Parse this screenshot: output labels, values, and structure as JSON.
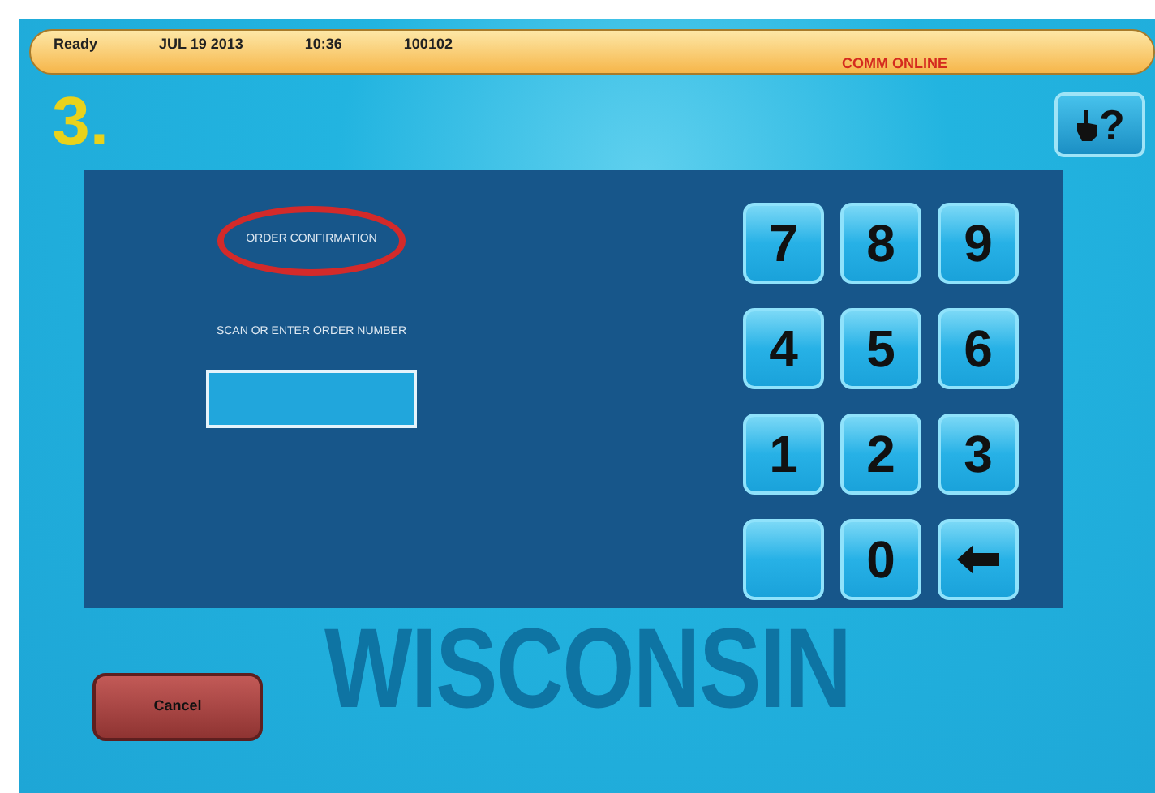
{
  "status_bar": {
    "status": "Ready",
    "date": "JUL 19 2013",
    "time": "10:36",
    "number": "100102",
    "connection": "COMM ONLINE"
  },
  "step": "3.",
  "help_button": {
    "label": "?"
  },
  "panel": {
    "title": "ORDER CONFIRMATION",
    "title_circled": true,
    "prompt": "SCAN OR ENTER ORDER NUMBER"
  },
  "keypad": [
    {
      "kind": "digit",
      "label": "7"
    },
    {
      "kind": "digit",
      "label": "8"
    },
    {
      "kind": "digit",
      "label": "9"
    },
    {
      "kind": "digit",
      "label": "4"
    },
    {
      "kind": "digit",
      "label": "5"
    },
    {
      "kind": "digit",
      "label": "6"
    },
    {
      "kind": "digit",
      "label": "1"
    },
    {
      "kind": "digit",
      "label": "2"
    },
    {
      "kind": "digit",
      "label": "3"
    },
    {
      "kind": "blank"
    },
    {
      "kind": "digit",
      "label": "0"
    },
    {
      "kind": "backspace"
    }
  ],
  "cancel_button": {
    "label": "Cancel"
  },
  "background_logo": {
    "text": "WISCONSIN"
  }
}
